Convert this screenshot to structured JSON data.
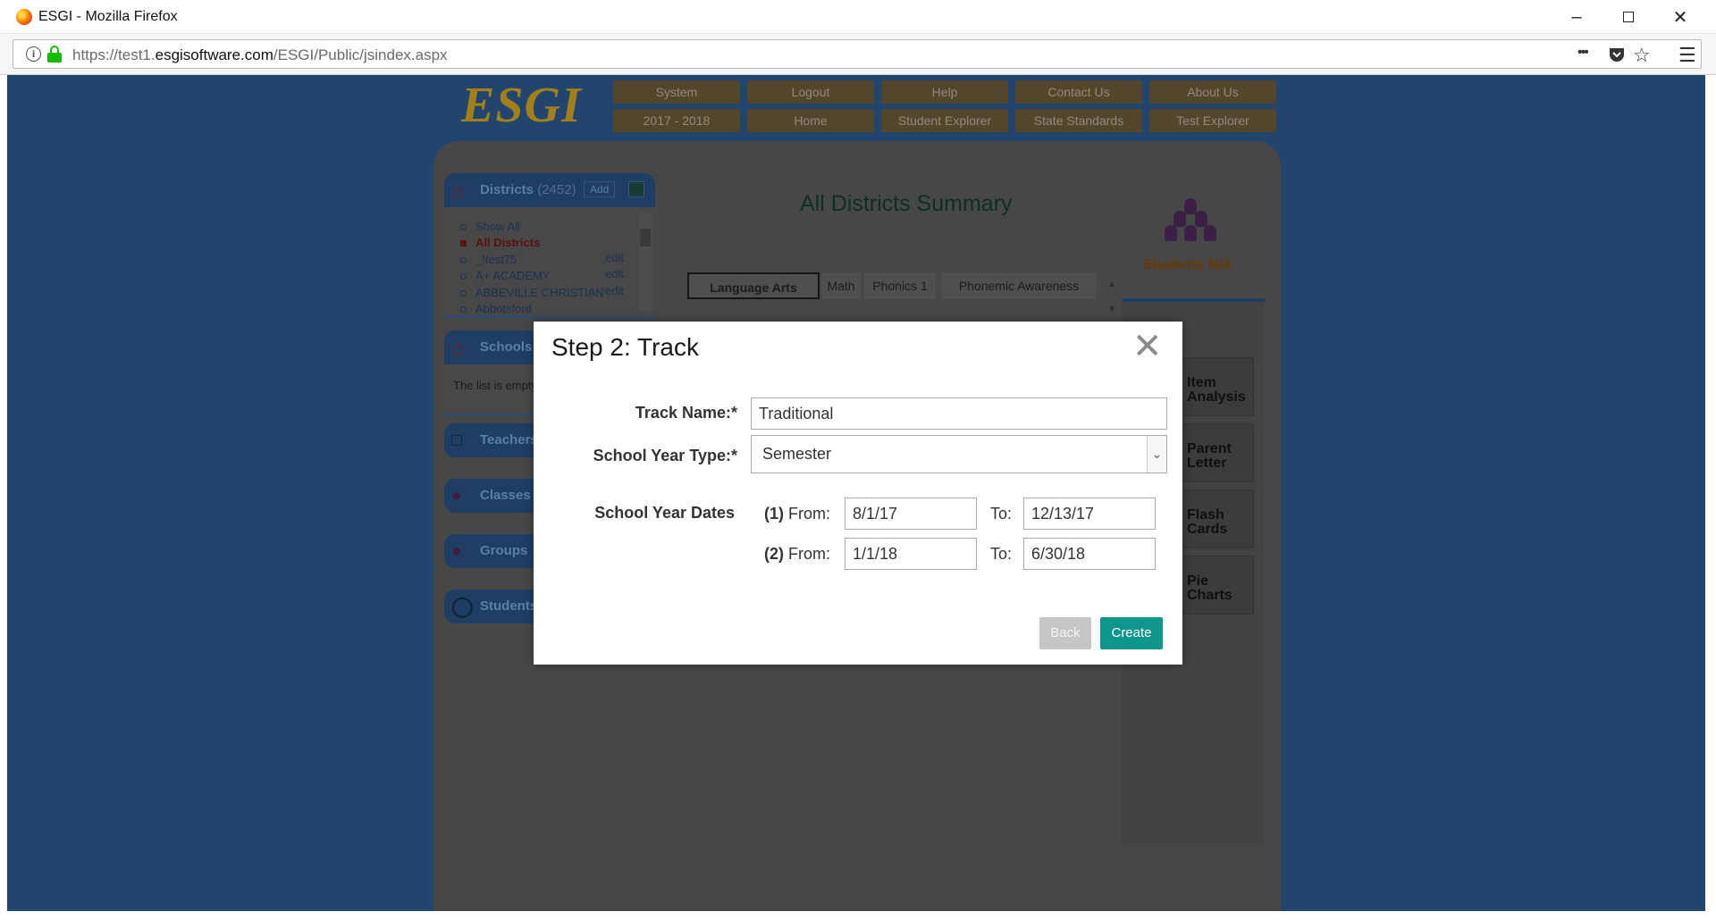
{
  "browser": {
    "window_title": "ESGI - Mozilla Firefox",
    "url_prefix": "https://test1.",
    "url_domain": "esgisoftware.com",
    "url_path": "/ESGI/Public/jsindex.aspx",
    "more_icon": "•••"
  },
  "header": {
    "logo": "ESGI",
    "nav_row1": [
      "System",
      "Logout",
      "Help",
      "Contact Us",
      "About Us"
    ],
    "nav_row2": [
      "2017 - 2018",
      "Home",
      "Student Explorer",
      "State Standards",
      "Test Explorer"
    ]
  },
  "sidebar": {
    "districts_label": "Districts",
    "districts_count": "(2452)",
    "add_label": "Add",
    "items": [
      {
        "label": "Show All",
        "edit": ""
      },
      {
        "label": "All Districts",
        "edit": ""
      },
      {
        "label": "_!test75",
        "edit": "edit"
      },
      {
        "label": "A+ ACADEMY",
        "edit": "edit"
      },
      {
        "label": "ABBEVILLE CHRISTIAN",
        "edit": "edit"
      },
      {
        "label": "Abbotsford",
        "edit": ""
      }
    ],
    "schools_label": "Schools",
    "schools_empty": "The list is empty",
    "teachers_label": "Teachers",
    "classes_label": "Classes",
    "groups_label": "Groups",
    "students_label": "Students"
  },
  "main": {
    "title": "All Districts Summary",
    "tabs": [
      "Language Arts",
      "Math",
      "Phonics 1",
      "Phonemic Awareness"
    ],
    "students_na": "Students N/A",
    "tiles": [
      "Item Analysis",
      "Parent Letter",
      "Flash Cards",
      "Pie Charts"
    ]
  },
  "modal": {
    "title": "Step 2: Track",
    "close_glyph": "✕",
    "track_name_label": "Track Name:*",
    "track_name_value": "Traditional",
    "school_year_type_label": "School Year Type:*",
    "school_year_type_value": "Semester",
    "school_year_dates_label": "School Year Dates",
    "period1_label": "(1)",
    "period2_label": "(2)",
    "from_label": "From:",
    "to_label": "To:",
    "period1_from": "8/1/17",
    "period1_to": "12/13/17",
    "period2_from": "1/1/18",
    "period2_to": "6/30/18",
    "back_label": "Back",
    "create_label": "Create"
  },
  "colors": {
    "create_button": "#0e958e",
    "page_background": "#22456e"
  }
}
